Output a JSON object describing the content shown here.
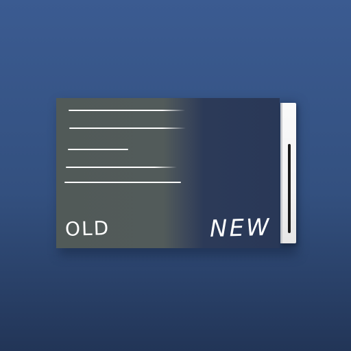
{
  "labels": {
    "old": "OLD",
    "new": "NEW"
  },
  "colors": {
    "background_top": "#3b5b91",
    "background_bottom": "#223557",
    "old_panel": "#515a58",
    "new_panel": "#293857",
    "text": "#ffffff",
    "scrollbar_track": "#f2f2f2",
    "scrollbar_thumb": "#1b1b1b"
  },
  "icons": {
    "text_lines": "text-lines-icon",
    "scrollbar": "scrollbar-icon"
  }
}
